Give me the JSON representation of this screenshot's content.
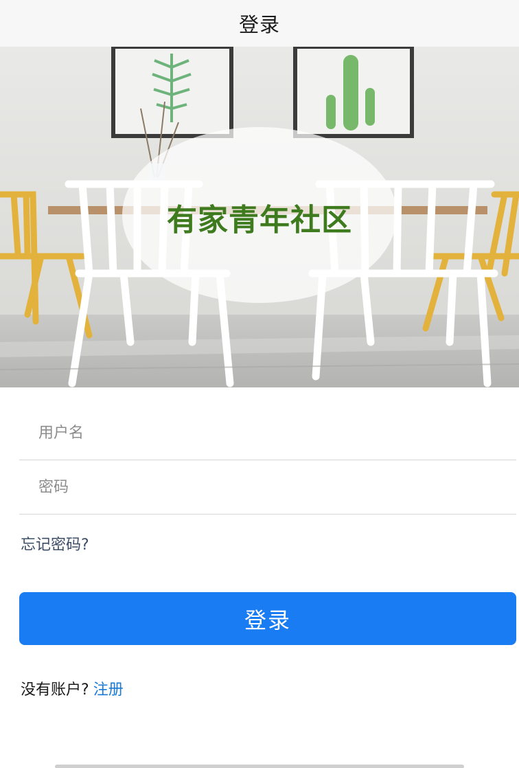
{
  "navbar": {
    "title": "登录"
  },
  "hero": {
    "overlay_text": "有家青年社区"
  },
  "form": {
    "username_placeholder": "用户名",
    "username_value": "",
    "password_placeholder": "密码",
    "password_value": "",
    "forgot_label": "忘记密码?",
    "login_label": "登录"
  },
  "register": {
    "prompt": "没有账户?",
    "link_label": "注册"
  },
  "colors": {
    "accent": "#1a7cf3",
    "link": "#1a7ad6",
    "hero_title": "#3e7a1e"
  }
}
